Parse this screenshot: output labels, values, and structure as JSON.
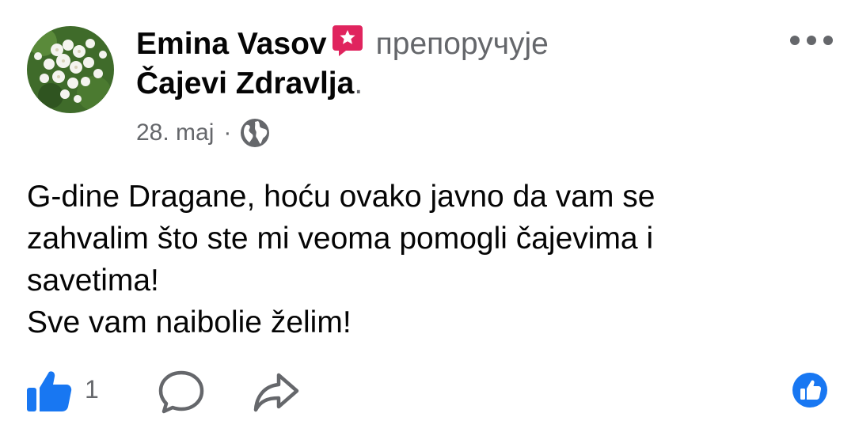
{
  "post": {
    "author": "Emina Vasov",
    "action": "препоручује",
    "page_name": "Čajevi Zdravlja",
    "period": ".",
    "date": "28. maj",
    "separator": "·",
    "body_lines": [
      "G-dine Dragane, hoću ovako javno da vam se",
      "zahvalim što ste mi veoma pomogli čajevima i",
      "savetima!",
      "Sve vam naibolie želim!"
    ]
  },
  "footer": {
    "like_count": "1"
  },
  "icons": {
    "recommend": "recommend-badge-icon",
    "audience": "globe-icon",
    "more": "more-options-icon",
    "like": "thumbs-up-icon",
    "comment": "comment-icon",
    "share": "share-icon",
    "reaction": "like-reaction-icon"
  },
  "colors": {
    "text": "#050505",
    "secondary": "#65676b",
    "facebook_blue": "#1877f2",
    "recommend_red": "#e0245e"
  }
}
